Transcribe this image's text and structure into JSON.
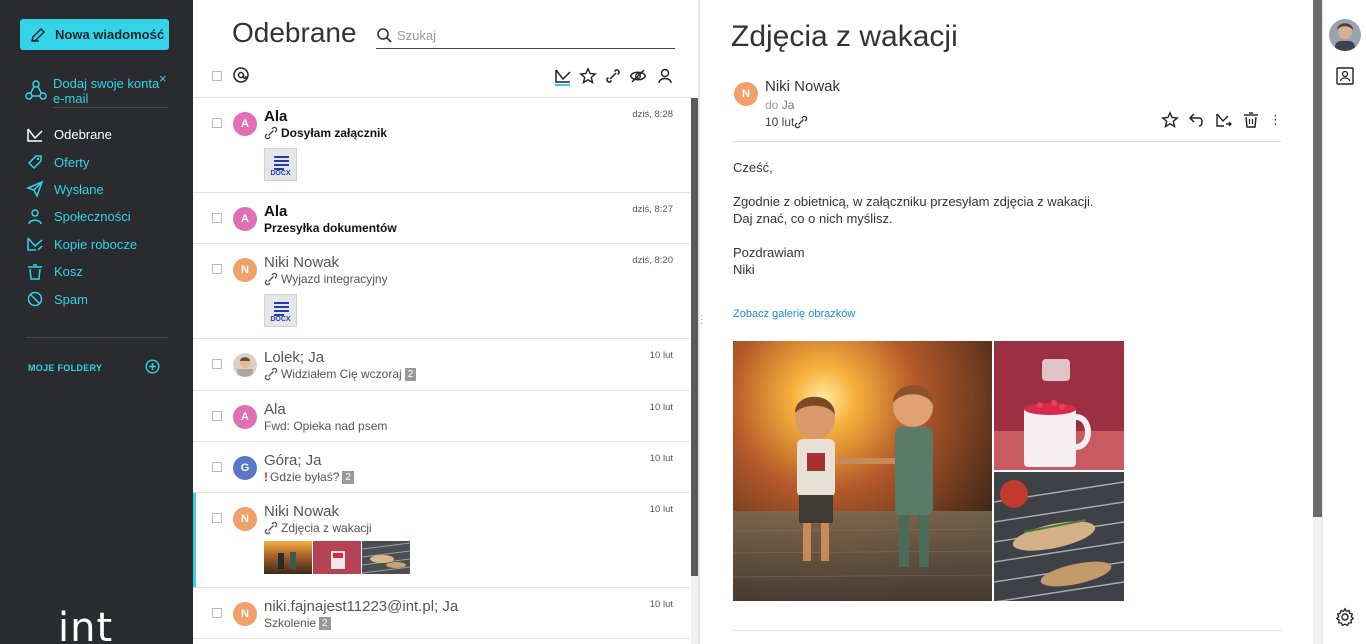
{
  "sidebar": {
    "compose_label": "Nowa wiadomość",
    "add_accounts_label": "Dodaj swoje konta e-mail",
    "add_accounts_close": "×",
    "folders": [
      {
        "label": "Odebrane",
        "icon": "inbox-icon",
        "active": true
      },
      {
        "label": "Oferty",
        "icon": "tag-icon",
        "active": false
      },
      {
        "label": "Wysłane",
        "icon": "sent-icon",
        "active": false
      },
      {
        "label": "Społeczności",
        "icon": "people-icon",
        "active": false
      },
      {
        "label": "Kopie robocze",
        "icon": "drafts-icon",
        "active": false
      },
      {
        "label": "Kosz",
        "icon": "trash-icon",
        "active": false
      },
      {
        "label": "Spam",
        "icon": "spam-icon",
        "active": false
      }
    ],
    "my_folders_label": "MOJE FOLDERY",
    "brand": "int"
  },
  "list": {
    "title": "Odebrane",
    "search_placeholder": "Szukaj",
    "messages": [
      {
        "sender": "Ala",
        "subject": "Dosyłam załącznik",
        "date": "dziś, 8:28",
        "unread": true,
        "avatar": "A",
        "avatar_color": "#e06fb4",
        "attachment": true,
        "preview": "docx",
        "preview_label": "DOCX"
      },
      {
        "sender": "Ala",
        "subject": "Przesyłka dokumentów",
        "date": "dziś, 8:27",
        "unread": true,
        "avatar": "A",
        "avatar_color": "#e06fb4"
      },
      {
        "sender": "Niki Nowak",
        "subject": "Wyjazd integracyjny",
        "date": "dziś, 8:20",
        "unread": false,
        "avatar": "N",
        "avatar_color": "#f0a06a",
        "attachment": true,
        "preview": "docx",
        "preview_label": "DOCX"
      },
      {
        "sender": "Lolek; Ja",
        "subject": "Widziałem Cię wczoraj",
        "date": "10 lut",
        "unread": false,
        "avatar_photo": true,
        "attachment": true,
        "count": "2"
      },
      {
        "sender": "Ala",
        "subject": "Fwd: Opieka nad psem",
        "date": "10 lut",
        "unread": false,
        "avatar": "A",
        "avatar_color": "#e06fb4"
      },
      {
        "sender": "Góra; Ja",
        "subject": "Gdzie byłaś?",
        "date": "10 lut",
        "unread": false,
        "avatar": "G",
        "avatar_color": "#5b78c8",
        "important": "!",
        "count": "2"
      },
      {
        "sender": "Niki Nowak",
        "subject": "Zdjęcia z wakacji",
        "date": "10 lut",
        "unread": false,
        "avatar": "N",
        "avatar_color": "#f0a06a",
        "attachment": true,
        "preview": "photos",
        "selected": true
      },
      {
        "sender": "niki.fajnajest11223@int.pl; Ja",
        "subject": "Szkolenie",
        "date": "10 lut",
        "unread": false,
        "avatar": "N",
        "avatar_color": "#f0a06a",
        "count": "2"
      }
    ]
  },
  "reader": {
    "title": "Zdjęcia z wakacji",
    "from": "Niki Nowak",
    "avatar": "N",
    "to_prefix": "do",
    "to": "Ja",
    "date": "10 lut",
    "body": {
      "greeting": "Cześć,",
      "line1": "Zgodnie z obietnicą, w załączniku przesyłam zdjęcia z wakacji.",
      "line2": "Daj znać, co o nich myślisz.",
      "closing": "Pozdrawiam",
      "signature": "Niki"
    },
    "gallery_link": "Zobacz galerię obrazków",
    "more": "⋮"
  },
  "colors": {
    "accent": "#35d3e8",
    "sidebar_bg": "#292b2e"
  }
}
